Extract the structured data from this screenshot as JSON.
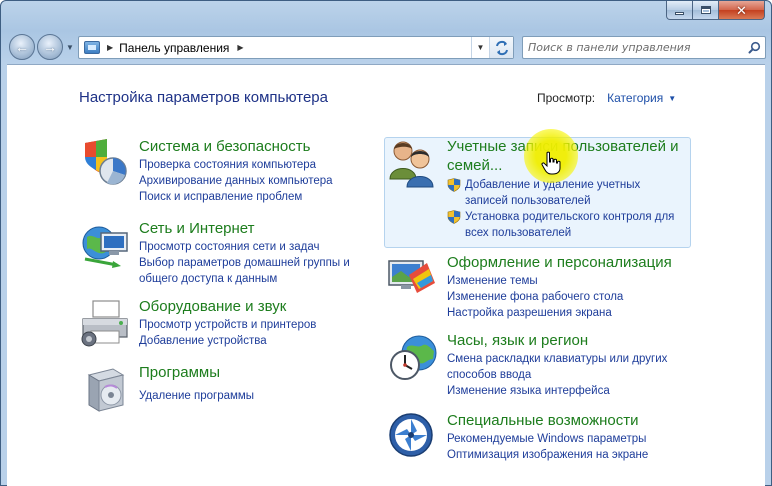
{
  "breadcrumb": {
    "root": "Панель управления"
  },
  "search": {
    "placeholder": "Поиск в панели управления"
  },
  "main": {
    "title": "Настройка параметров компьютера",
    "view_label": "Просмотр:",
    "view_value": "Категория"
  },
  "categories": [
    {
      "title": "Система и безопасность",
      "icon": "shield-pie-icon",
      "links": [
        "Проверка состояния компьютера",
        "Архивирование данных компьютера",
        "Поиск и исправление проблем"
      ]
    },
    {
      "title": "Сеть и Интернет",
      "icon": "network-globe-icon",
      "links": [
        "Просмотр состояния сети и задач",
        "Выбор параметров домашней группы и общего доступа к данным"
      ]
    },
    {
      "title": "Оборудование и звук",
      "icon": "printer-icon",
      "links": [
        "Просмотр устройств и принтеров",
        "Добавление устройства"
      ]
    },
    {
      "title": "Программы",
      "icon": "programs-box-icon",
      "links": [
        "Удаление программы"
      ]
    },
    {
      "title": "Учетные записи пользователей и семей...",
      "icon": "users-icon",
      "links": [
        "Добавление и удаление учетных записей пользователей",
        "Установка родительского контроля для всех пользователей"
      ]
    },
    {
      "title": "Оформление и персонализация",
      "icon": "monitor-palette-icon",
      "links": [
        "Изменение темы",
        "Изменение фона рабочего стола",
        "Настройка разрешения экрана"
      ]
    },
    {
      "title": "Часы, язык и регион",
      "icon": "clock-globe-icon",
      "links": [
        "Смена раскладки клавиатуры или других способов ввода",
        "Изменение языка интерфейса"
      ]
    },
    {
      "title": "Специальные возможности",
      "icon": "accessibility-icon",
      "links": [
        "Рекомендуемые Windows параметры",
        "Оптимизация изображения на экране"
      ]
    }
  ],
  "colors": {
    "category_title": "#1d7d1d",
    "link": "#1e3d9a",
    "page_title": "#1e3287",
    "hover_bg": "#eaf4fd"
  }
}
